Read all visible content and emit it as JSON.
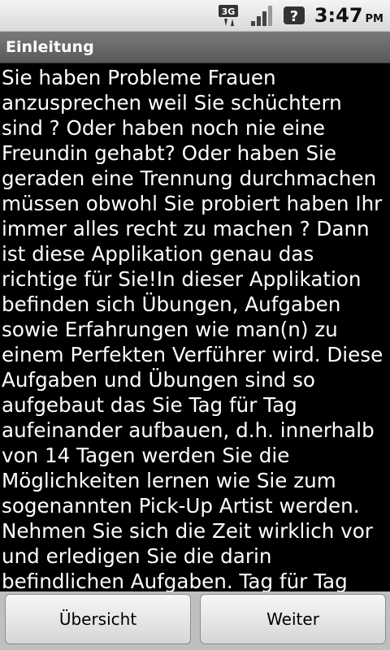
{
  "status_bar": {
    "network_label": "3G",
    "time": "3:47",
    "ampm": "PM",
    "icons": [
      "3g-data-icon",
      "signal-strength-icon",
      "unknown-status-icon"
    ]
  },
  "title_bar": {
    "title": "Einleitung"
  },
  "content": {
    "text": "Sie haben Probleme Frauen anzusprechen weil Sie schüchtern sind ? Oder haben noch nie eine Freundin gehabt? Oder haben Sie geraden eine Trennung durchmachen müssen obwohl Sie probiert haben Ihr immer alles recht zu machen ? Dann ist diese Applikation genau das richtige für Sie!In dieser Applikation befinden sich Übungen, Aufgaben sowie Erfahrungen wie man(n) zu einem Perfekten Verführer wird. Diese Aufgaben und Übungen sind so aufgebaut das Sie Tag für Tag aufeinander aufbauen, d.h. innerhalb von 14 Tagen werden Sie die Möglichkeiten lernen wie Sie zum sogenannten Pick-Up Artist werden. Nehmen Sie sich die Zeit wirklich vor und erledigen Sie die darin befindlichen Aufgaben. Tag für Tag"
  },
  "buttons": {
    "left_label": "Übersicht",
    "right_label": "Weiter"
  }
}
